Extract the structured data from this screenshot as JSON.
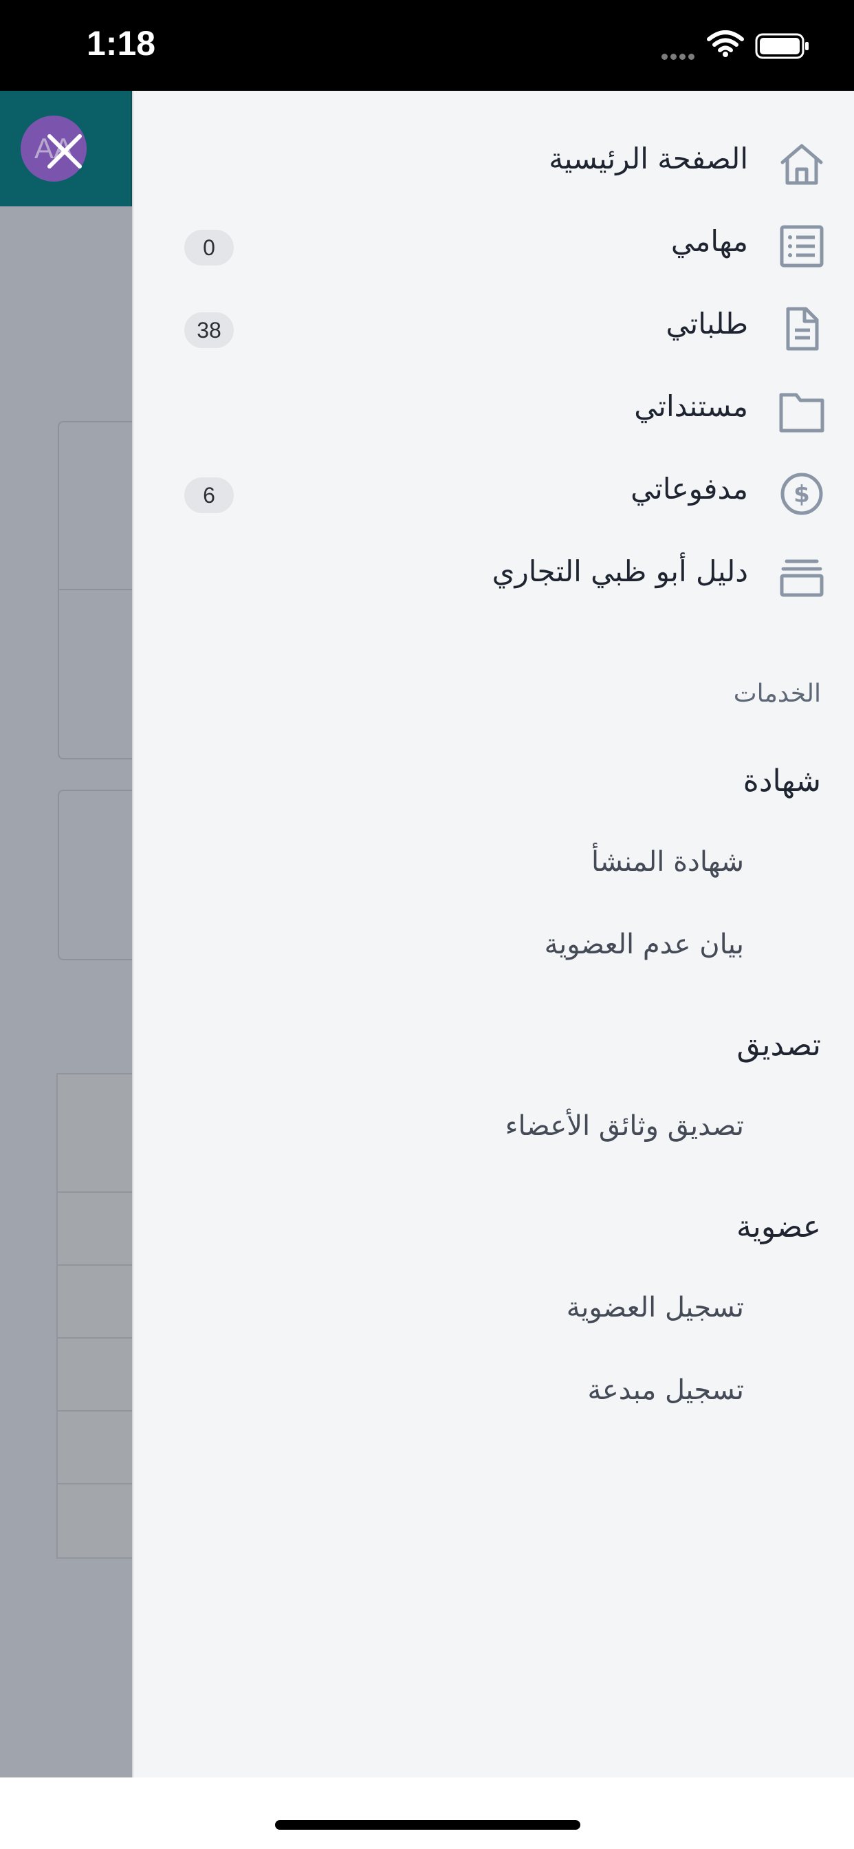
{
  "status_bar": {
    "time": "1:18"
  },
  "header": {
    "avatar_initials": "AA"
  },
  "nav": {
    "items": [
      {
        "label": "الصفحة الرئيسية",
        "icon": "home-icon",
        "badge": null
      },
      {
        "label": "مهامي",
        "icon": "list-icon",
        "badge": "0"
      },
      {
        "label": "طلباتي",
        "icon": "document-icon",
        "badge": "38"
      },
      {
        "label": "مستنداتي",
        "icon": "folder-icon",
        "badge": null
      },
      {
        "label": "مدفوعاتي",
        "icon": "dollar-circle-icon",
        "badge": "6"
      },
      {
        "label": "دليل أبو ظبي التجاري",
        "icon": "directory-icon",
        "badge": null
      }
    ]
  },
  "services": {
    "title": "الخدمات",
    "groups": [
      {
        "title": "شهادة",
        "items": [
          "شهادة المنشأ",
          "بيان عدم العضوية"
        ]
      },
      {
        "title": "تصديق",
        "items": [
          "تصديق وثائق الأعضاء"
        ]
      },
      {
        "title": "عضوية",
        "items": [
          "تسجيل العضوية",
          "تسجيل مبدعة"
        ]
      }
    ]
  },
  "colors": {
    "header_teal": "#0b5f66",
    "avatar_purple": "#7b55ad",
    "drawer_bg": "#f4f5f7",
    "icon_gray": "#8a96a6"
  }
}
